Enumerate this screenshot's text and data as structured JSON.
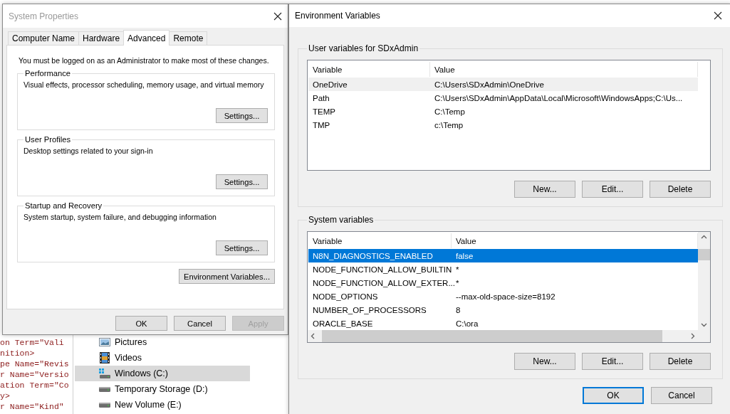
{
  "background": {
    "code_lines": [
      "on Term=\"Vali",
      "nition>",
      "pe Name=\"Revis",
      "r Name=\"Versio",
      "ation Term=\"Co",
      "y>",
      "r Name=\"Kind\""
    ],
    "explorer_items": [
      {
        "label": "Pictures",
        "kind": "pictures",
        "selected": false
      },
      {
        "label": "Videos",
        "kind": "videos",
        "selected": false
      },
      {
        "label": "Windows (C:)",
        "kind": "system",
        "selected": true
      },
      {
        "label": "Temporary Storage (D:)",
        "kind": "drive",
        "selected": false
      },
      {
        "label": "New Volume (E:)",
        "kind": "drive",
        "selected": false
      }
    ]
  },
  "system_properties": {
    "title": "System Properties",
    "tabs": [
      {
        "label": "Computer Name",
        "selected": false
      },
      {
        "label": "Hardware",
        "selected": false
      },
      {
        "label": "Advanced",
        "selected": true
      },
      {
        "label": "Remote",
        "selected": false
      }
    ],
    "notice": "You must be logged on as an Administrator to make most of these changes.",
    "groups": [
      {
        "title": "Performance",
        "description": "Visual effects, processor scheduling, memory usage, and virtual memory",
        "button": "Settings..."
      },
      {
        "title": "User Profiles",
        "description": "Desktop settings related to your sign-in",
        "button": "Settings..."
      },
      {
        "title": "Startup and Recovery",
        "description": "System startup, system failure, and debugging information",
        "button": "Settings..."
      }
    ],
    "environment_button": "Environment Variables...",
    "buttons": [
      {
        "label": "OK",
        "disabled": false
      },
      {
        "label": "Cancel",
        "disabled": false
      },
      {
        "label": "Apply",
        "disabled": true
      }
    ]
  },
  "environment_variables": {
    "title": "Environment Variables",
    "sections": [
      {
        "title": "User variables for SDxAdmin",
        "columns": [
          "Variable",
          "Value"
        ],
        "focused": false,
        "scrollbars": false,
        "rows": [
          {
            "variable": "OneDrive",
            "value": "C:\\Users\\SDxAdmin\\OneDrive",
            "selected": true
          },
          {
            "variable": "Path",
            "value": "C:\\Users\\SDxAdmin\\AppData\\Local\\Microsoft\\WindowsApps;C:\\Us...",
            "selected": false
          },
          {
            "variable": "TEMP",
            "value": "C:\\Temp",
            "selected": false
          },
          {
            "variable": "TMP",
            "value": "c:\\Temp",
            "selected": false
          }
        ],
        "buttons": [
          "New...",
          "Edit...",
          "Delete"
        ]
      },
      {
        "title": "System variables",
        "columns": [
          "Variable",
          "Value"
        ],
        "focused": true,
        "scrollbars": true,
        "rows": [
          {
            "variable": "N8N_DIAGNOSTICS_ENABLED",
            "value": "false",
            "selected": true
          },
          {
            "variable": "NODE_FUNCTION_ALLOW_BUILTIN",
            "value": "*",
            "selected": false
          },
          {
            "variable": "NODE_FUNCTION_ALLOW_EXTER...",
            "value": "*",
            "selected": false
          },
          {
            "variable": "NODE_OPTIONS",
            "value": "--max-old-space-size=8192",
            "selected": false
          },
          {
            "variable": "NUMBER_OF_PROCESSORS",
            "value": "8",
            "selected": false
          },
          {
            "variable": "ORACLE_BASE",
            "value": "C:\\ora",
            "selected": false
          }
        ],
        "buttons": [
          "New...",
          "Edit...",
          "Delete"
        ]
      }
    ],
    "buttons": [
      {
        "label": "OK",
        "default": true
      },
      {
        "label": "Cancel",
        "default": false
      }
    ]
  }
}
